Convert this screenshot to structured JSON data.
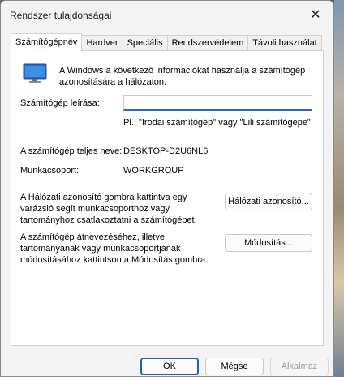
{
  "window": {
    "title": "Rendszer tulajdonságai",
    "close_glyph": "✕"
  },
  "tabs": [
    {
      "label": "Számítógépnév",
      "active": true
    },
    {
      "label": "Hardver",
      "active": false
    },
    {
      "label": "Speciális",
      "active": false
    },
    {
      "label": "Rendszervédelem",
      "active": false
    },
    {
      "label": "Távoli használat",
      "active": false
    }
  ],
  "content": {
    "intro_text": "A Windows a következő információkat használja a számítógép azonosítására a hálózaton.",
    "description_label": "Számítógép leírása:",
    "description_value": "",
    "description_hint": "Pl.: \"Irodai számítógép\" vagy \"Lili számítógépe\".",
    "full_name_label": "A számítógép teljes neve:",
    "full_name_value": "DESKTOP-D2U6NL6",
    "workgroup_label": "Munkacsoport:",
    "workgroup_value": "WORKGROUP",
    "network_id_text": "A Hálózati azonosító gombra kattintva egy varázsló segít munkacsoporthoz vagy tartományhoz csatlakoztatni a számítógépet.",
    "network_id_button": "Hálózati azonosító...",
    "rename_text": "A számítógép átnevezéséhez, illetve tartományának vagy munkacsoportjának módosításához kattintson a Módosítás gombra.",
    "change_button": "Módosítás..."
  },
  "footer": {
    "ok_label": "OK",
    "cancel_label": "Mégse",
    "apply_label": "Alkalmaz"
  },
  "colors": {
    "accent": "#2b64c4",
    "monitor_screen": "#1f6fc9"
  }
}
